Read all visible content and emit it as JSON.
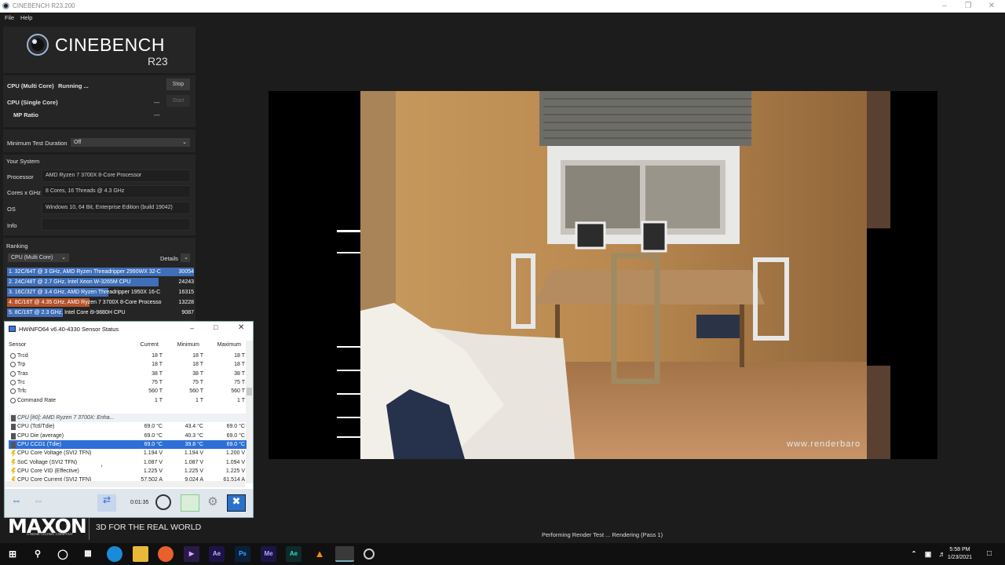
{
  "window": {
    "title": "CINEBENCH R23.200"
  },
  "menu": [
    "File",
    "Help"
  ],
  "brand": {
    "name": "CINEBENCH",
    "version": "R23"
  },
  "tests": {
    "multi": {
      "label": "CPU (Multi Core)",
      "status": "Running ...",
      "button": "Stop"
    },
    "single": {
      "label": "CPU (Single Core)",
      "status": "---",
      "button": "Start"
    },
    "mp": {
      "label": "MP Ratio",
      "status": "---"
    }
  },
  "min_duration": {
    "label": "Minimum Test Duration",
    "value": "Off"
  },
  "system": {
    "heading": "Your System",
    "processor_label": "Processor",
    "processor": "AMD Ryzen 7 3700X 8-Core Processor",
    "cores_label": "Cores x GHz",
    "cores": "8 Cores, 16 Threads @ 4.3 GHz",
    "os_label": "OS",
    "os": "Windows 10, 64 Bit, Enterprise Edition (build 19042)",
    "info_label": "Info",
    "info": ""
  },
  "ranking": {
    "heading": "Ranking",
    "select": "CPU (Multi Core)",
    "details": "Details",
    "items": [
      {
        "text": "1. 32C/64T @ 3 GHz, AMD Ryzen Threadripper 2990WX 32-C",
        "score": "30054",
        "fill": 1.0,
        "color": "#3f6fb8"
      },
      {
        "text": "2. 24C/48T @ 2.7 GHz, Intel Xeon W-3265M CPU",
        "score": "24243",
        "fill": 0.81,
        "color": "#3f6fb8"
      },
      {
        "text": "3. 16C/32T @ 3.4 GHz, AMD Ryzen Threadripper 1950X 16-C",
        "score": "16315",
        "fill": 0.54,
        "color": "#3f6fb8"
      },
      {
        "text": "4. 8C/16T @ 4.35 GHz, AMD Ryzen 7 3700X 8-Core Processo",
        "score": "13228",
        "fill": 0.44,
        "color": "#b4532a"
      },
      {
        "text": "5. 8C/16T @ 2.3 GHz, Intel Core i9-9880H CPU",
        "score": "9087",
        "fill": 0.3,
        "color": "#3f6fb8"
      }
    ]
  },
  "hwinfo": {
    "title": "HWiNFO64 v6.40-4330 Sensor Status",
    "columns": [
      "Sensor",
      "Current",
      "Minimum",
      "Maximum"
    ],
    "rows": [
      {
        "icon": "circle",
        "name": "Trcd",
        "cur": "18 T",
        "min": "18 T",
        "max": "18 T"
      },
      {
        "icon": "circle",
        "name": "Trp",
        "cur": "18 T",
        "min": "18 T",
        "max": "18 T"
      },
      {
        "icon": "circle",
        "name": "Tras",
        "cur": "38 T",
        "min": "38 T",
        "max": "38 T"
      },
      {
        "icon": "circle",
        "name": "Trc",
        "cur": "75 T",
        "min": "75 T",
        "max": "75 T"
      },
      {
        "icon": "circle",
        "name": "Trfc",
        "cur": "560 T",
        "min": "560 T",
        "max": "560 T"
      },
      {
        "icon": "circle",
        "name": "Command Rate",
        "cur": "1 T",
        "min": "1 T",
        "max": "1 T"
      },
      {
        "icon": "none",
        "name": "",
        "cur": "",
        "min": "",
        "max": ""
      },
      {
        "icon": "chip",
        "name": "CPU [#0]: AMD Ryzen 7 3700X: Enha...",
        "cur": "",
        "min": "",
        "max": "",
        "group": true
      },
      {
        "icon": "temp",
        "name": "CPU (Tctl/Tdie)",
        "cur": "69.0 °C",
        "min": "43.4 °C",
        "max": "69.0 °C"
      },
      {
        "icon": "temp",
        "name": "CPU Die (average)",
        "cur": "69.0 °C",
        "min": "40.3 °C",
        "max": "69.0 °C"
      },
      {
        "icon": "temp",
        "name": "CPU CCD1 (Tdie)",
        "cur": "69.0 °C",
        "min": "39.8 °C",
        "max": "69.0 °C",
        "selected": true
      },
      {
        "icon": "bolt",
        "name": "CPU Core Voltage (SVI2 TFN)",
        "cur": "1.194 V",
        "min": "1.194 V",
        "max": "1.200 V"
      },
      {
        "icon": "bolt",
        "name": "SoC Voltage (SVI2 TFN)",
        "cur": "1.087 V",
        "min": "1.087 V",
        "max": "1.094 V"
      },
      {
        "icon": "bolt",
        "name": "CPU Core VID (Effective)",
        "cur": "1.225 V",
        "min": "1.225 V",
        "max": "1.225 V"
      },
      {
        "icon": "bolt",
        "name": "CPU Core Current (SVI2 TFN)",
        "cur": "57.502 A",
        "min": "9.024 A",
        "max": "61.514 A"
      }
    ],
    "timer": "0:01:35"
  },
  "watermark": "www.renderbaro",
  "footer": {
    "maxon": "MAXON",
    "maxon_sub": "A NEMETSCHEK COMPANY",
    "tagline": "3D FOR THE REAL WORLD",
    "status": "Performing Render Test ... Rendering (Pass 1)"
  },
  "taskbar": {
    "time": "5:58 PM",
    "date": "1/23/2021",
    "apps": [
      "windows-start",
      "search",
      "cortana",
      "task-view",
      "edge",
      "file-explorer",
      "firefox",
      "premiere-rush",
      "after-effects",
      "photoshop",
      "media-encoder",
      "audition",
      "vlc",
      "hwinfo",
      "cinebench"
    ],
    "app_labels": {
      "premiere": "Pr",
      "after_effects": "Ae",
      "photoshop": "Ps",
      "media_encoder": "Me",
      "audition": "Ae"
    }
  }
}
